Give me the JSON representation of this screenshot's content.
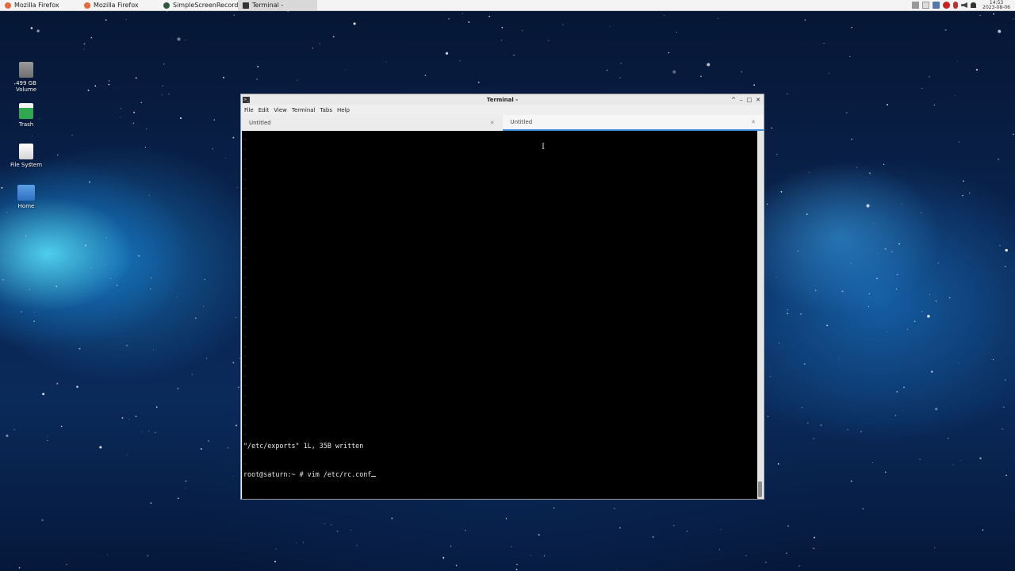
{
  "taskbar": {
    "tasks": [
      {
        "label": "Mozilla Firefox",
        "icon": "firefox-icon"
      },
      {
        "label": "Mozilla Firefox",
        "icon": "firefox-icon"
      },
      {
        "label": "SimpleScreenRecorder",
        "icon": "record-icon"
      },
      {
        "label": "Terminal -",
        "icon": "terminal-icon"
      }
    ],
    "clock": {
      "time": "14:53",
      "date": "2023-08-06"
    }
  },
  "desktop": {
    "icons": [
      {
        "label": "499 GB Volume",
        "icon": "drive-icon"
      },
      {
        "label": "Trash",
        "icon": "trash-icon"
      },
      {
        "label": "File System",
        "icon": "filesystem-icon"
      },
      {
        "label": "Home",
        "icon": "home-folder-icon"
      }
    ]
  },
  "window": {
    "title": "Terminal -",
    "menu": [
      "File",
      "Edit",
      "View",
      "Terminal",
      "Tabs",
      "Help"
    ],
    "tabs": [
      {
        "label": "Untitled",
        "active": false
      },
      {
        "label": "Untitled",
        "active": true
      }
    ],
    "terminal": {
      "lines": [
        "\"/etc/exports\" 1L, 35B written",
        "root@saturn:~ # vim /etc/rc.conf"
      ]
    }
  },
  "colors": {
    "accent": "#3d8ee0",
    "terminal_bg": "#000000",
    "terminal_fg": "#e8e8e8"
  }
}
